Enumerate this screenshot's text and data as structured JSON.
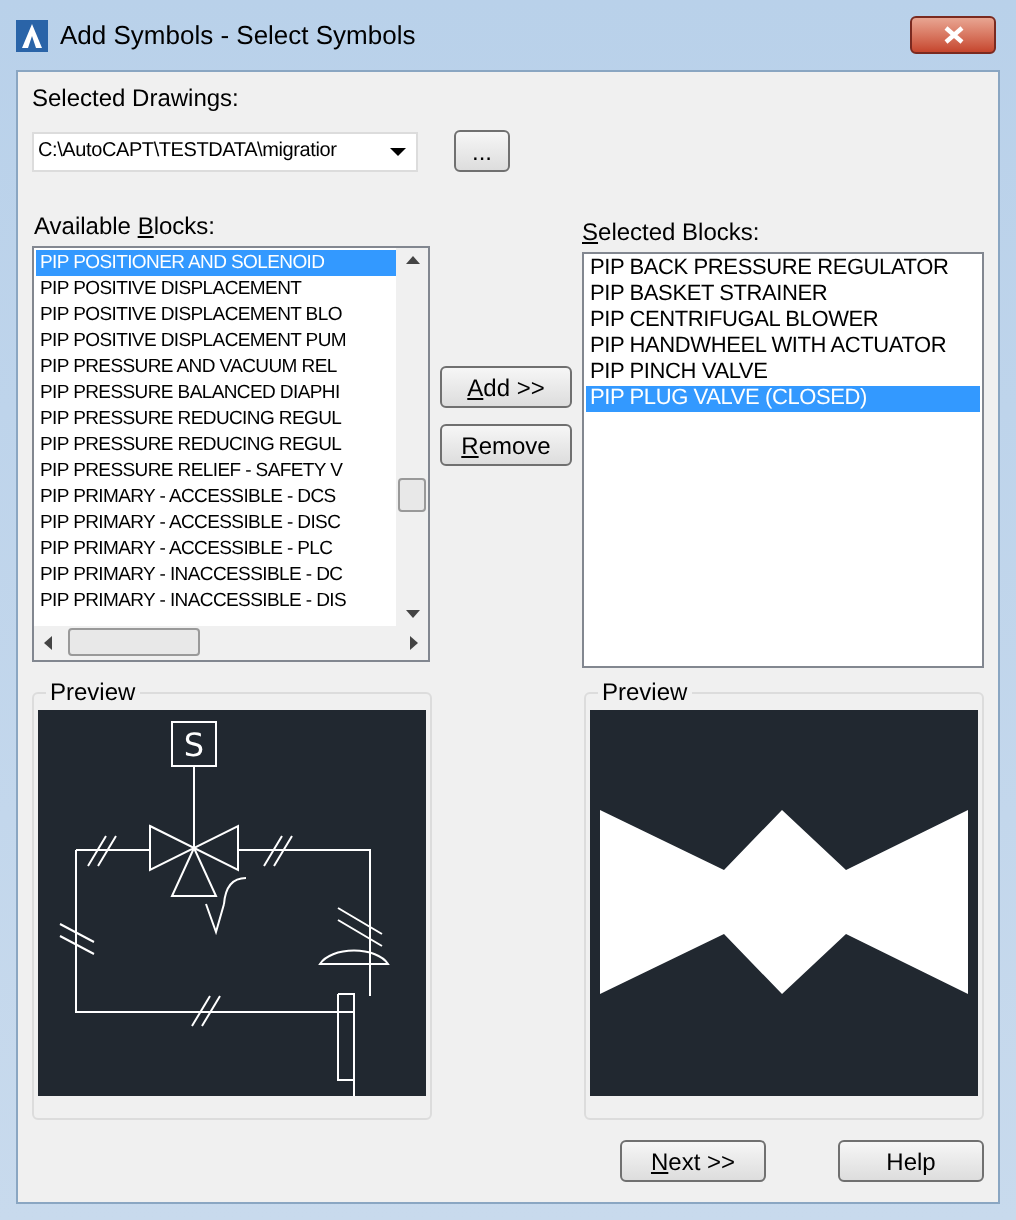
{
  "window": {
    "title": "Add Symbols - Select Symbols"
  },
  "drawings": {
    "label": "Selected Drawings:",
    "value": "C:\\AutoCAPT\\TESTDATA\\migratior",
    "browse": "..."
  },
  "available": {
    "label": {
      "before": "Available ",
      "key": "B",
      "after": "locks:"
    },
    "items": [
      {
        "text": "PIP POSITIONER AND SOLENOID",
        "selected": true
      },
      {
        "text": "PIP POSITIVE DISPLACEMENT",
        "selected": false
      },
      {
        "text": "PIP POSITIVE DISPLACEMENT BLO",
        "selected": false
      },
      {
        "text": "PIP POSITIVE DISPLACEMENT PUM",
        "selected": false
      },
      {
        "text": "PIP PRESSURE AND VACUUM REL",
        "selected": false
      },
      {
        "text": "PIP PRESSURE BALANCED DIAPHI",
        "selected": false
      },
      {
        "text": "PIP PRESSURE REDUCING REGUL",
        "selected": false
      },
      {
        "text": "PIP PRESSURE REDUCING REGUL",
        "selected": false
      },
      {
        "text": "PIP PRESSURE RELIEF - SAFETY V",
        "selected": false
      },
      {
        "text": "PIP PRIMARY - ACCESSIBLE - DCS",
        "selected": false
      },
      {
        "text": "PIP PRIMARY - ACCESSIBLE - DISC",
        "selected": false
      },
      {
        "text": "PIP PRIMARY - ACCESSIBLE - PLC",
        "selected": false
      },
      {
        "text": "PIP PRIMARY - INACCESSIBLE - DC",
        "selected": false
      },
      {
        "text": "PIP PRIMARY - INACCESSIBLE - DIS",
        "selected": false
      }
    ]
  },
  "buttons": {
    "add": {
      "key": "A",
      "after": "dd >>"
    },
    "remove": {
      "key": "R",
      "after": "emove"
    }
  },
  "selected_blocks": {
    "label": {
      "key": "S",
      "after": "elected Blocks:"
    },
    "items": [
      {
        "text": "PIP BACK PRESSURE REGULATOR",
        "selected": false
      },
      {
        "text": "PIP BASKET STRAINER",
        "selected": false
      },
      {
        "text": "PIP CENTRIFUGAL BLOWER",
        "selected": false
      },
      {
        "text": "PIP HANDWHEEL WITH ACTUATOR",
        "selected": false
      },
      {
        "text": "PIP PINCH VALVE",
        "selected": false
      },
      {
        "text": "PIP PLUG VALVE (CLOSED)",
        "selected": true
      }
    ]
  },
  "previews": [
    {
      "title": "Preview",
      "kind": "positioner",
      "symbol_letter": "S"
    },
    {
      "title": "Preview",
      "kind": "plug_valve"
    }
  ],
  "footer": {
    "next": {
      "key": "N",
      "after": "ext >>"
    },
    "help": {
      "after": "Help"
    }
  }
}
